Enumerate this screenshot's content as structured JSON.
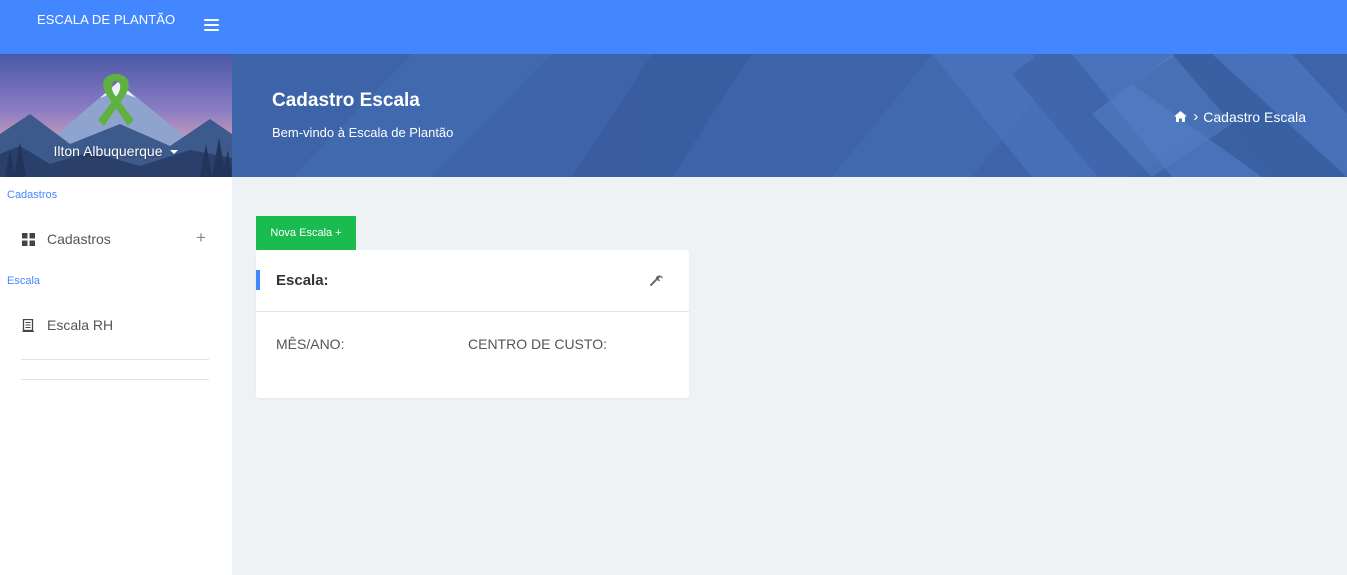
{
  "topbar": {
    "brand": "ESCALA DE PLANTÃO",
    "menu_icon": "hamburger-icon"
  },
  "sidebar": {
    "user": {
      "name": "Ilton Albuquerque"
    },
    "sections": [
      {
        "label": "Cadastros",
        "items": [
          {
            "label": "Cadastros",
            "icon": "grid-icon",
            "expand": "+"
          }
        ]
      },
      {
        "label": "Escala",
        "items": [
          {
            "label": "Escala RH",
            "icon": "document-icon"
          }
        ]
      }
    ]
  },
  "header": {
    "title": "Cadastro Escala",
    "subtitle": "Bem-vindo à Escala de Plantão",
    "breadcrumb": {
      "separator": "›",
      "current": "Cadastro Escala",
      "home_icon": "home-icon"
    }
  },
  "main": {
    "new_button": "Nova Escala +",
    "card": {
      "title": "Escala:",
      "tool_icon": "wrench-icon",
      "fields": [
        {
          "label": "MÊS/ANO:"
        },
        {
          "label": "CENTRO DE CUSTO:"
        }
      ]
    }
  },
  "colors": {
    "primary": "#4287ff",
    "banner": "#3d63a8",
    "success": "#1abc50",
    "background": "#eef2f5"
  }
}
